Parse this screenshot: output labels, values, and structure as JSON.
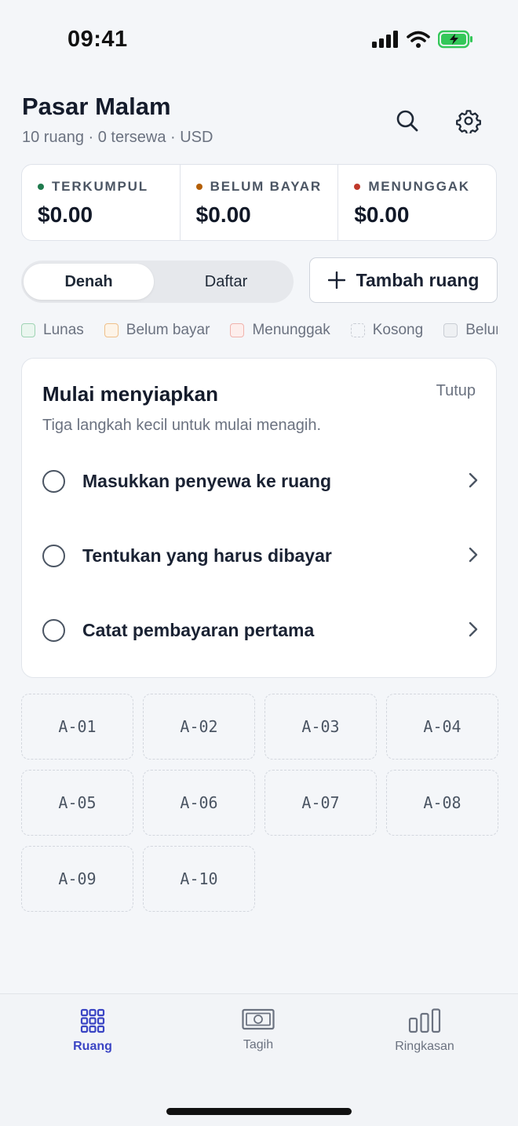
{
  "status_bar": {
    "time": "09:41"
  },
  "header": {
    "title": "Pasar Malam",
    "subtitle": "10 ruang · 0 tersewa · USD"
  },
  "stats": [
    {
      "label": "TERKUMPUL",
      "value": "$0.00",
      "color": "#1f7a4d"
    },
    {
      "label": "BELUM BAYAR",
      "value": "$0.00",
      "color": "#b45f06"
    },
    {
      "label": "MENUNGGAK",
      "value": "$0.00",
      "color": "#c0392b"
    }
  ],
  "view_toggle": {
    "active": "Denah",
    "inactive": "Daftar"
  },
  "add_button": {
    "label": "Tambah ruang"
  },
  "legend": [
    {
      "label": "Lunas",
      "border": "#9fd3b4",
      "fill": "#eaf6ef",
      "dashed": false
    },
    {
      "label": "Belum bayar",
      "border": "#efc08a",
      "fill": "#fdf4e8",
      "dashed": false
    },
    {
      "label": "Menunggak",
      "border": "#f0b3ad",
      "fill": "#fdeeec",
      "dashed": false
    },
    {
      "label": "Kosong",
      "border": "#c9cdd4",
      "fill": "transparent",
      "dashed": true
    },
    {
      "label": "Belum",
      "border": "#c9cdd4",
      "fill": "#eef0f3",
      "dashed": false
    }
  ],
  "onboarding": {
    "title": "Mulai menyiapkan",
    "close": "Tutup",
    "subtitle": "Tiga langkah kecil untuk mulai menagih.",
    "steps": [
      "Masukkan penyewa ke ruang",
      "Tentukan yang harus dibayar",
      "Catat pembayaran pertama"
    ]
  },
  "spaces": [
    "A-01",
    "A-02",
    "A-03",
    "A-04",
    "A-05",
    "A-06",
    "A-07",
    "A-08",
    "A-09",
    "A-10"
  ],
  "tabs": [
    {
      "label": "Ruang",
      "active": true
    },
    {
      "label": "Tagih",
      "active": false
    },
    {
      "label": "Ringkasan",
      "active": false
    }
  ],
  "colors": {
    "accent": "#3b45c4",
    "battery": "#34c759"
  }
}
